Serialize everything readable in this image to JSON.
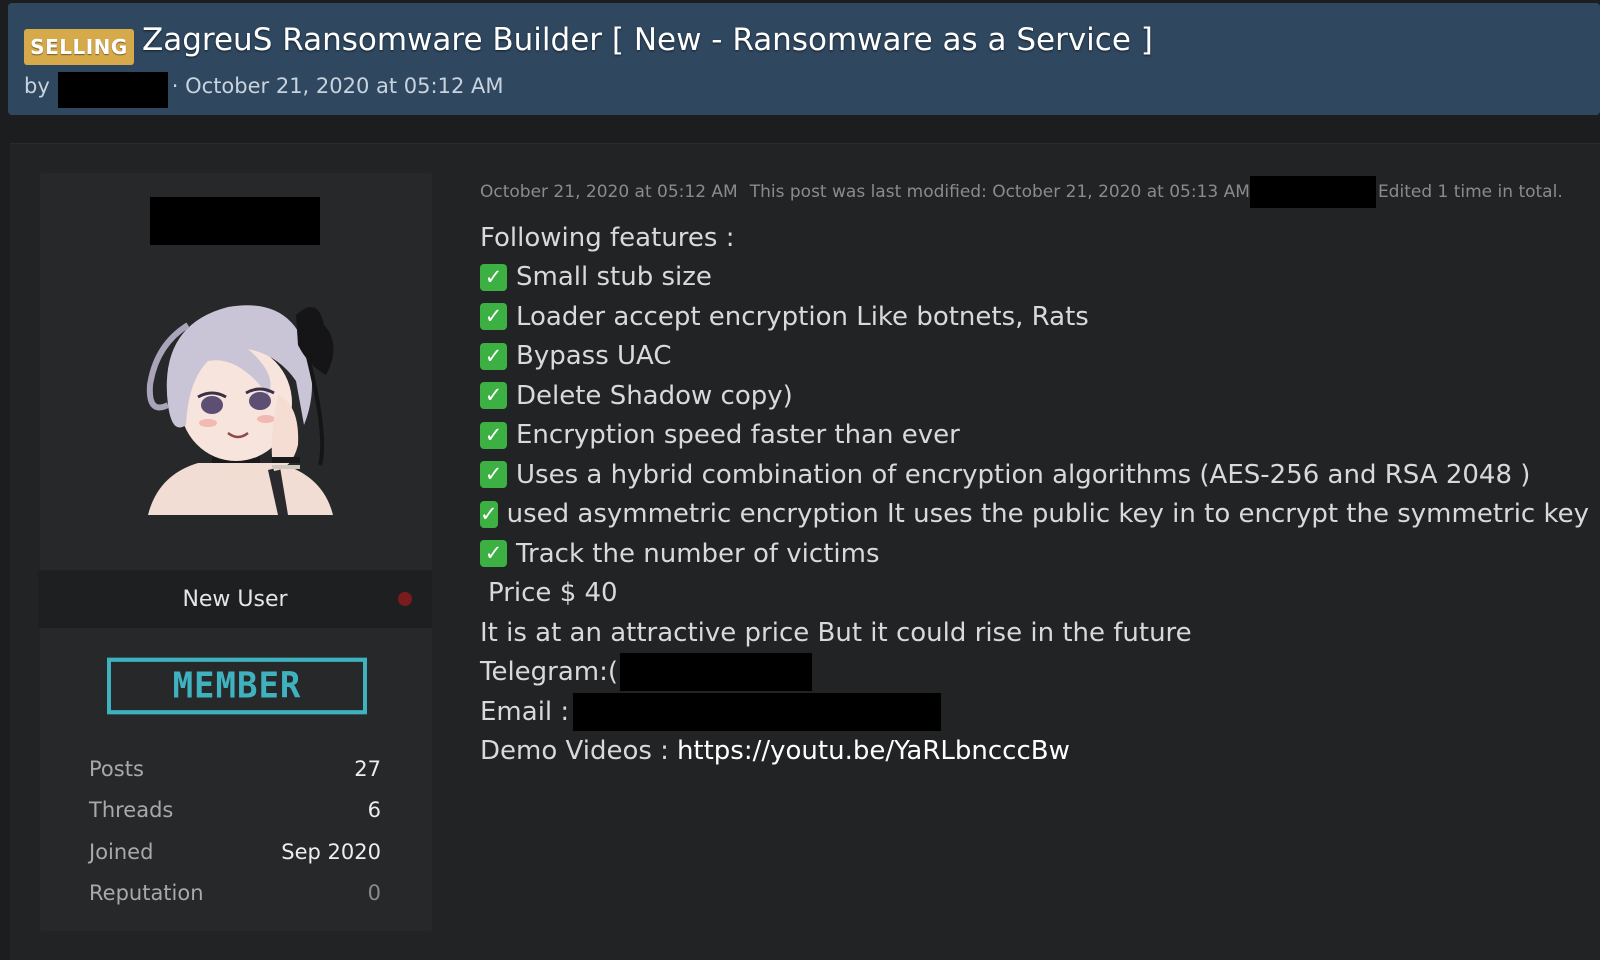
{
  "thread": {
    "prefix": "SELLING",
    "title": "ZagreuS Ransomware Builder [ New - Ransomware as a Service ]",
    "by_label": "by",
    "date": "· October 21, 2020 at 05:12 AM"
  },
  "author": {
    "rank": "New User",
    "badge": "MEMBER",
    "stats": [
      {
        "label": "Posts",
        "value": "27"
      },
      {
        "label": "Threads",
        "value": "6"
      },
      {
        "label": "Joined",
        "value": "Sep 2020"
      },
      {
        "label": "Reputation",
        "value": "0"
      }
    ]
  },
  "post": {
    "date": "October 21, 2020 at 05:12 AM",
    "modified": "This post was last modified: October 21, 2020 at 05:13 AM",
    "edited": "Edited 1 time in total.",
    "intro": "Following features :",
    "check_icon": "✅",
    "features": [
      "Small stub size",
      "Loader accept encryption Like botnets, Rats",
      "Bypass UAC",
      "Delete Shadow copy)",
      "Encryption speed faster than ever",
      "Uses a hybrid combination of encryption algorithms (AES-256 and RSA 2048 )",
      "used asymmetric encryption It uses the public key in to encrypt the symmetric key",
      "Track the number of victims"
    ],
    "price": "Price $ 40",
    "note": "It is at an attractive price But it could rise in the future",
    "telegram_label": "Telegram:(",
    "email_label": "Email :",
    "demo_label": "Demo Videos :",
    "demo_url": "https://youtu.be/YaRLbncccBw"
  },
  "colors": {
    "header_bg": "#2f4860",
    "prefix_bg": "#d6a94a",
    "member_badge": "#3fb2c0",
    "check_green": "#3cb043",
    "offline_dot": "#7a1c1c"
  }
}
